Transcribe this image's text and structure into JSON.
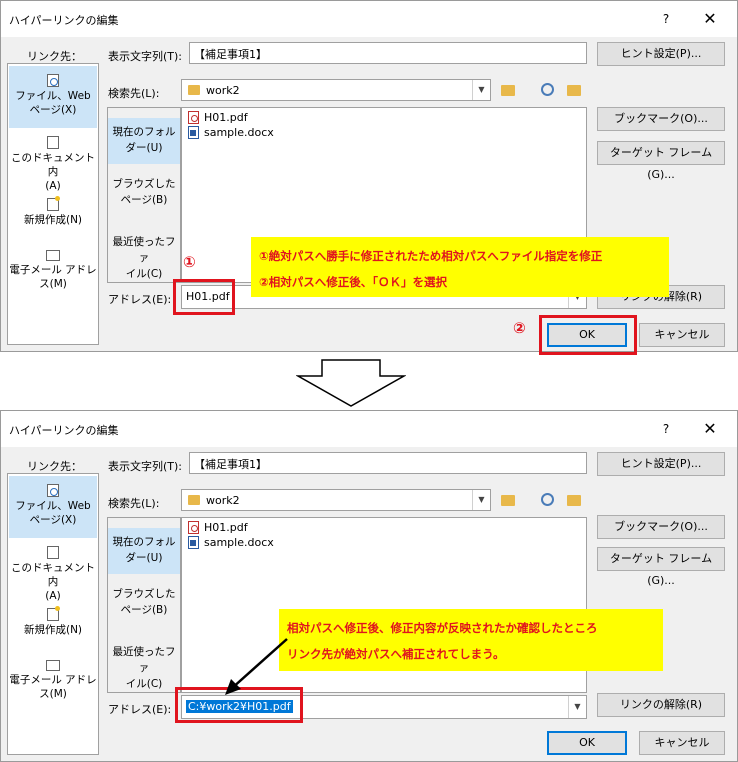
{
  "dialog1": {
    "title": "ハイパーリンクの編集",
    "help": "?",
    "close": "✕",
    "link_to_label": "リンク先：",
    "nav": [
      {
        "l1": "ファイル、Web",
        "l2": "ページ(X)"
      },
      {
        "l1": "このドキュメント内",
        "l2": "(A)"
      },
      {
        "l1": "新規作成(N)",
        "l2": ""
      },
      {
        "l1": "電子メール アドレ",
        "l2": "ス(M)"
      }
    ],
    "display_text_label": "表示文字列(T):",
    "display_text_value": "【補足事項1】",
    "screentip_button": "ヒント設定(P)...",
    "look_in_label": "検索先(L):",
    "look_in_value": "work2",
    "side": [
      {
        "l1": "現在のフォル",
        "l2": "ダー(U)"
      },
      {
        "l1": "ブラウズした",
        "l2": "ページ(B)"
      },
      {
        "l1": "最近使ったファ",
        "l2": "イル(C)"
      }
    ],
    "files": [
      "H01.pdf",
      "sample.docx"
    ],
    "bookmark_button": "ブックマーク(O)...",
    "target_frame_button": "ターゲット フレーム(G)...",
    "address_label": "アドレス(E):",
    "address_value": "H01.pdf",
    "remove_link_button": "リンクの解除(R)",
    "ok_button": "OK",
    "cancel_button": "キャンセル",
    "marker1": "①",
    "marker2": "②",
    "note_line1": "①絶対パスへ勝手に修正されたため相対パスへファイル指定を修正",
    "note_line2": "②相対パスへ修正後、「ＯＫ」を選択"
  },
  "dialog2": {
    "title": "ハイパーリンクの編集",
    "help": "?",
    "close": "✕",
    "link_to_label": "リンク先：",
    "nav": [
      {
        "l1": "ファイル、Web",
        "l2": "ページ(X)"
      },
      {
        "l1": "このドキュメント内",
        "l2": "(A)"
      },
      {
        "l1": "新規作成(N)",
        "l2": ""
      },
      {
        "l1": "電子メール アドレ",
        "l2": "ス(M)"
      }
    ],
    "display_text_label": "表示文字列(T):",
    "display_text_value": "【補足事項1】",
    "screentip_button": "ヒント設定(P)...",
    "look_in_label": "検索先(L):",
    "look_in_value": "work2",
    "side": [
      {
        "l1": "現在のフォル",
        "l2": "ダー(U)"
      },
      {
        "l1": "ブラウズした",
        "l2": "ページ(B)"
      },
      {
        "l1": "最近使ったファ",
        "l2": "イル(C)"
      }
    ],
    "files": [
      "H01.pdf",
      "sample.docx"
    ],
    "bookmark_button": "ブックマーク(O)...",
    "target_frame_button": "ターゲット フレーム(G)...",
    "address_label": "アドレス(E):",
    "address_value": "C:¥work2¥H01.pdf",
    "remove_link_button": "リンクの解除(R)",
    "ok_button": "OK",
    "cancel_button": "キャンセル",
    "note_line1": "相対パスへ修正後、修正内容が反映されたか確認したところ",
    "note_line2": "リンク先が絶対パスへ補正されてしまう。"
  },
  "colors": {
    "annotation_red": "#e0141e",
    "note_yellow": "#ffff00",
    "selection_blue": "#cce4f7",
    "highlight_blue": "#0078d7"
  }
}
